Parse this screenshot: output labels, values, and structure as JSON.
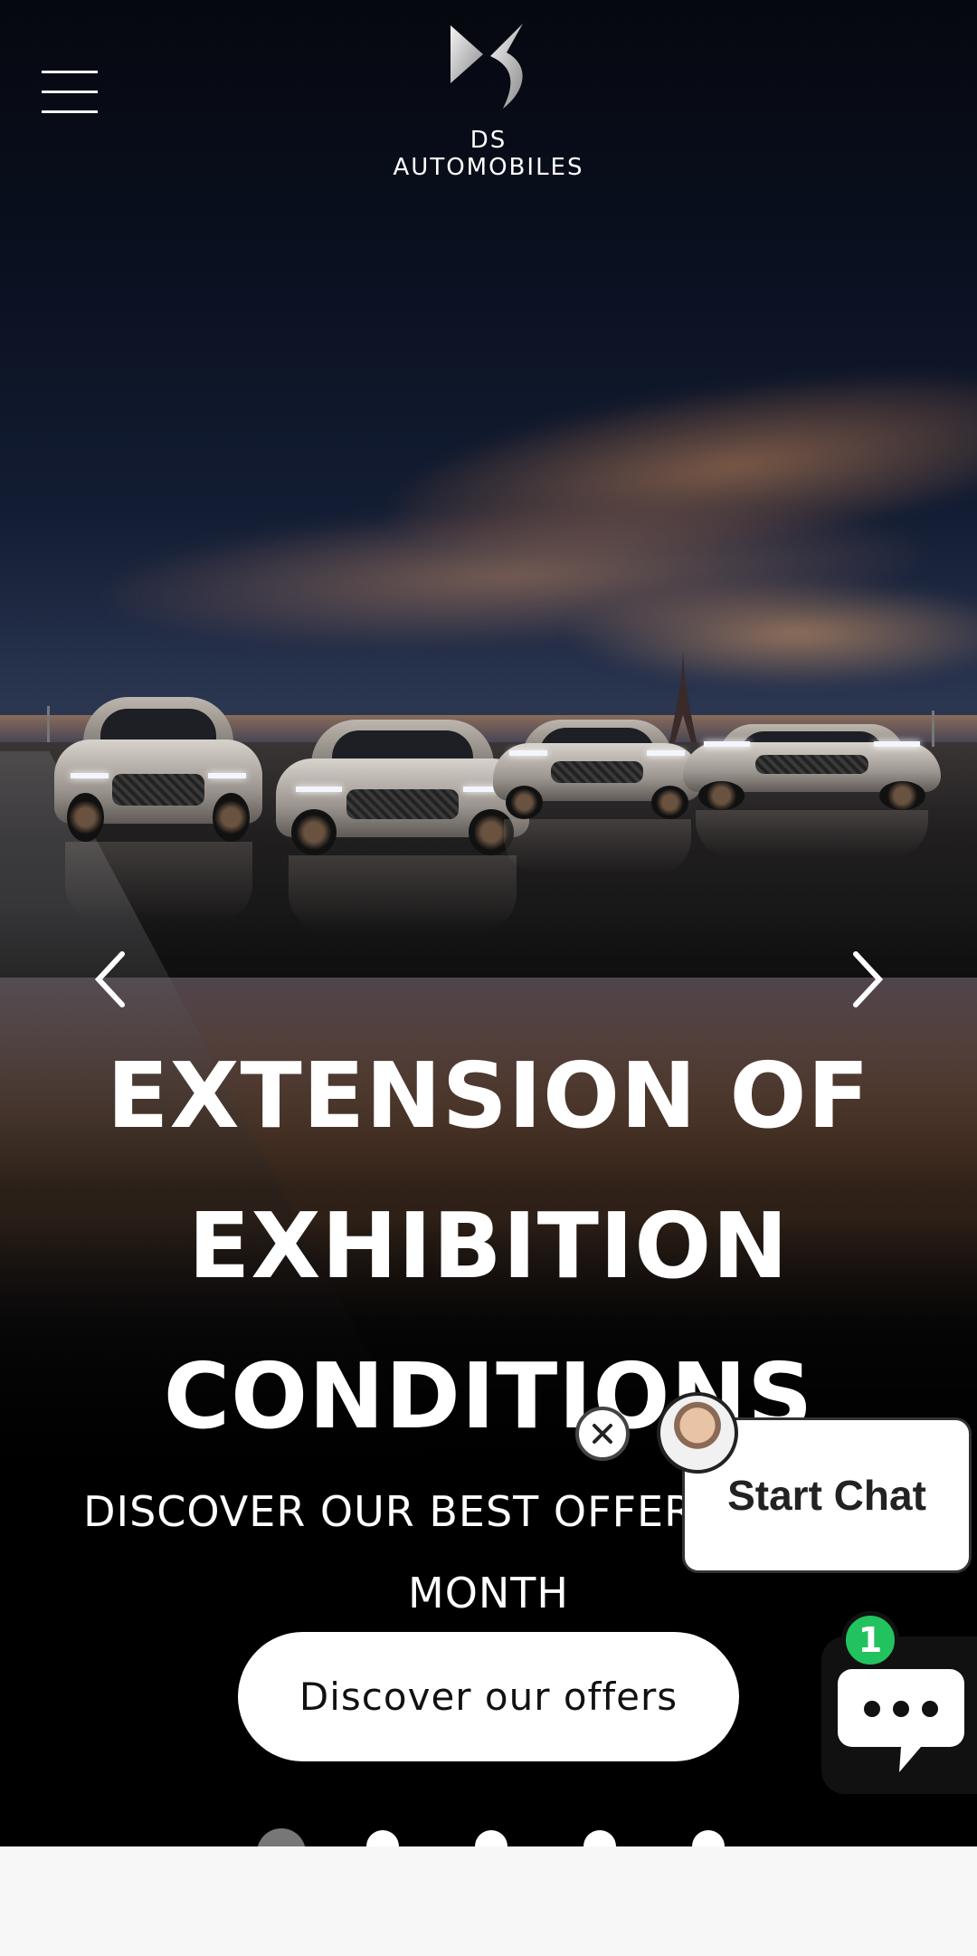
{
  "header": {
    "brand_name": "DS AUTOMOBILES",
    "menu_icon": "hamburger-menu-icon",
    "logo_icon": "ds-logo-icon"
  },
  "hero": {
    "headline_lines": [
      "EXTENSION OF",
      "EXHIBITION",
      "CONDITIONS"
    ],
    "subline_lines": [
      "DISCOVER OUR BEST OFFERS OF THE",
      "MONTH"
    ],
    "cta_label": "Discover our offers",
    "prev_icon": "chevron-left-icon",
    "next_icon": "chevron-right-icon",
    "slide_count": 5,
    "active_slide": 1
  },
  "chat": {
    "start_label": "Start Chat",
    "badge_count": "1",
    "close_icon": "close-icon",
    "launcher_icon": "chat-bubble-icon"
  },
  "colors": {
    "badge_green": "#22c35e",
    "button_white": "#ffffff",
    "bottom_bar": "#f7f7f7"
  }
}
